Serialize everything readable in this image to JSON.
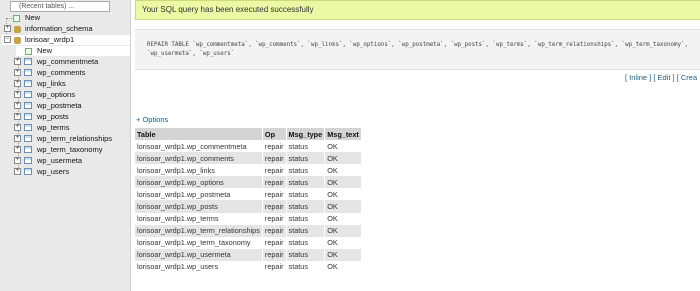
{
  "nav": {
    "select_label": "(Recent tables) ...",
    "new_label": "New",
    "databases": [
      {
        "name": "information_schema"
      },
      {
        "name": "lorisoar_wrdp1"
      }
    ],
    "db_new_label": "New",
    "tables": [
      "wp_commentmeta",
      "wp_comments",
      "wp_links",
      "wp_options",
      "wp_postmeta",
      "wp_posts",
      "wp_terms",
      "wp_term_relationships",
      "wp_term_taxonomy",
      "wp_usermeta",
      "wp_users"
    ]
  },
  "main": {
    "success_message": "Your SQL query has been executed successfully",
    "sql_query": "REPAIR TABLE `wp_commentmeta`, `wp_comments`, `wp_links`, `wp_options`, `wp_postmeta`, `wp_posts`, `wp_terms`, `wp_term_relationships`, `wp_term_taxonomy`, `wp_usermeta`, `wp_users`",
    "links": {
      "inline": "[ Inline ]",
      "edit": "[ Edit ]",
      "create": "[ Crea"
    },
    "options_label": "+ Options",
    "columns": [
      "Table",
      "Op",
      "Msg_type",
      "Msg_text"
    ],
    "rows": [
      [
        "lorisoar_wrdp1.wp_commentmeta",
        "repair",
        "status",
        "OK"
      ],
      [
        "lorisoar_wrdp1.wp_comments",
        "repair",
        "status",
        "OK"
      ],
      [
        "lorisoar_wrdp1.wp_links",
        "repair",
        "status",
        "OK"
      ],
      [
        "lorisoar_wrdp1.wp_options",
        "repair",
        "status",
        "OK"
      ],
      [
        "lorisoar_wrdp1.wp_postmeta",
        "repair",
        "status",
        "OK"
      ],
      [
        "lorisoar_wrdp1.wp_posts",
        "repair",
        "status",
        "OK"
      ],
      [
        "lorisoar_wrdp1.wp_terms",
        "repair",
        "status",
        "OK"
      ],
      [
        "lorisoar_wrdp1.wp_term_relationships",
        "repair",
        "status",
        "OK"
      ],
      [
        "lorisoar_wrdp1.wp_term_taxonomy",
        "repair",
        "status",
        "OK"
      ],
      [
        "lorisoar_wrdp1.wp_usermeta",
        "repair",
        "status",
        "OK"
      ],
      [
        "lorisoar_wrdp1.wp_users",
        "repair",
        "status",
        "OK"
      ]
    ]
  }
}
